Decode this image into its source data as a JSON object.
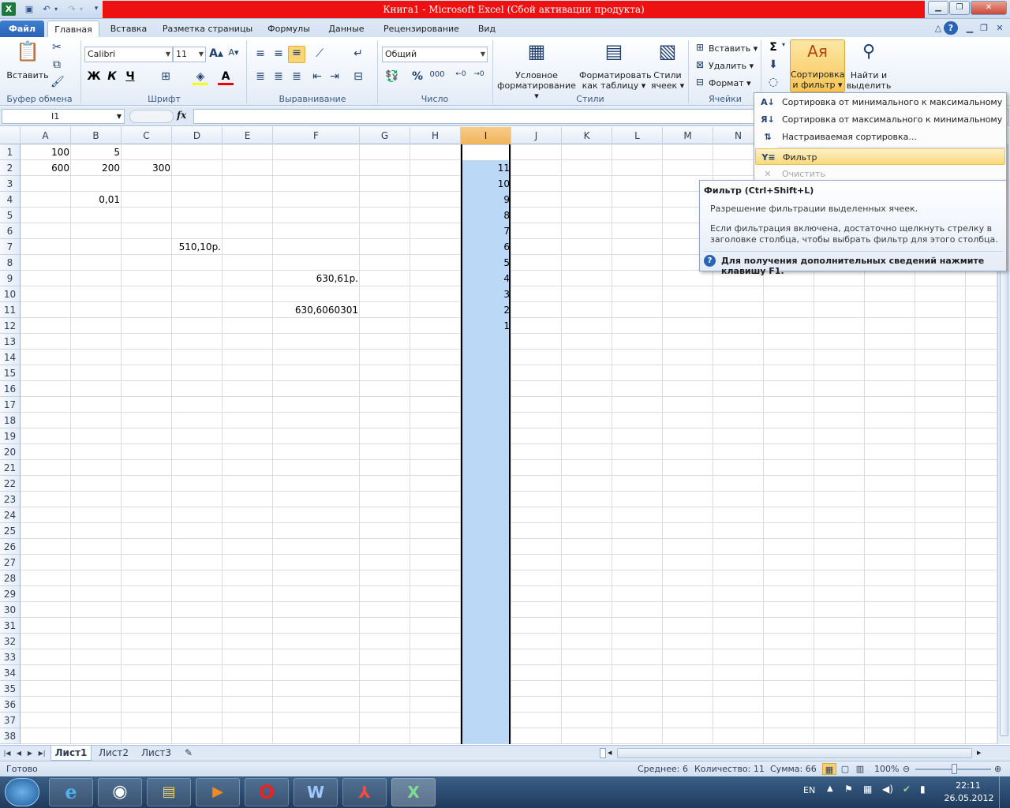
{
  "window": {
    "title": "Книга1  -  Microsoft Excel (Сбой активации продукта)"
  },
  "tabs": [
    "Файл",
    "Главная",
    "Вставка",
    "Разметка страницы",
    "Формулы",
    "Данные",
    "Рецензирование",
    "Вид"
  ],
  "ribbon": {
    "clipboard": {
      "paste": "Вставить",
      "group": "Буфер обмена"
    },
    "font": {
      "name": "Calibri",
      "size": "11",
      "bold": "Ж",
      "italic": "К",
      "underline": "Ч",
      "group": "Шрифт"
    },
    "alignment": {
      "group": "Выравнивание"
    },
    "number": {
      "format": "Общий",
      "group": "Число"
    },
    "styles": {
      "conditional_1": "Условное",
      "conditional_2": "форматирование",
      "table_1": "Форматировать",
      "table_2": "как таблицу",
      "cell_1": "Стили",
      "cell_2": "ячеек",
      "group": "Стили"
    },
    "cells": {
      "insert": "Вставить",
      "delete": "Удалить",
      "format": "Формат",
      "group": "Ячейки"
    },
    "editing": {
      "sort_1": "Сортировка",
      "sort_2": "и фильтр",
      "find_1": "Найти и",
      "find_2": "выделить"
    }
  },
  "formula_bar": {
    "name_box": "I1",
    "fx": "fx",
    "value": ""
  },
  "columns": [
    "A",
    "B",
    "C",
    "D",
    "E",
    "F",
    "G",
    "H",
    "I",
    "J",
    "K",
    "L",
    "M",
    "N"
  ],
  "rows": [
    "1",
    "2",
    "3",
    "4",
    "5",
    "6",
    "7",
    "8",
    "9",
    "10",
    "11",
    "12",
    "13",
    "14",
    "15",
    "16",
    "17",
    "18",
    "19",
    "20",
    "21",
    "22",
    "23",
    "24",
    "25",
    "26",
    "27",
    "28",
    "29",
    "30",
    "31",
    "32",
    "33",
    "34",
    "35",
    "36",
    "37",
    "38"
  ],
  "cells": {
    "A1": "100",
    "B1": "5",
    "A2": "600",
    "B2": "200",
    "C2": "300",
    "B4": "0,01",
    "D7": "510,10р.",
    "F9": "630,61р.",
    "F11": "630,6060301",
    "I2": "11",
    "I3": "10",
    "I4": "9",
    "I5": "8",
    "I6": "7",
    "I7": "6",
    "I8": "5",
    "I9": "4",
    "I10": "3",
    "I11": "2",
    "I12": "1"
  },
  "sheets": [
    "Лист1",
    "Лист2",
    "Лист3"
  ],
  "status": {
    "ready": "Готово",
    "average": "Среднее: 6",
    "count": "Количество: 11",
    "sum": "Сумма: 66",
    "zoom": "100%"
  },
  "sort_menu": {
    "asc": "Сортировка от минимального к максимальному",
    "desc": "Сортировка от максимального к минимальному",
    "custom": "Настраиваемая сортировка...",
    "filter": "Фильтр",
    "clear": "Очистить"
  },
  "tooltip": {
    "title": "Фильтр (Ctrl+Shift+L)",
    "line1": "Разрешение фильтрации выделенных ячеек.",
    "line2": "Если фильтрация включена, достаточно щелкнуть стрелку в",
    "line3": "заголовке столбца, чтобы выбрать фильтр для этого столбца.",
    "help": "Для получения дополнительных сведений нажмите клавишу F1."
  },
  "taskbar": {
    "lang": "EN",
    "time": "22:11",
    "date": "26.05.2012"
  },
  "colors": {
    "accent": "#2a62b4",
    "title_red": "#ee1111",
    "selection": "#bcd8f7",
    "header_selected": "#f2b45a"
  }
}
